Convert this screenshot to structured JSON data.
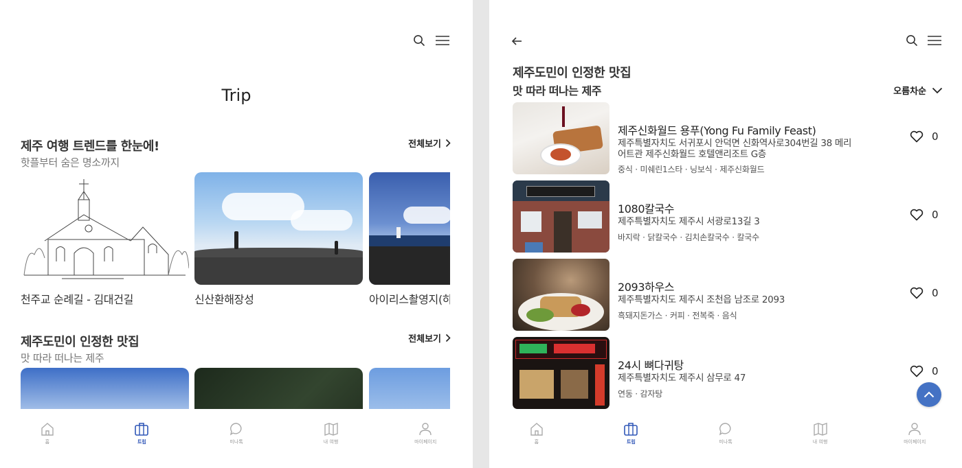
{
  "left": {
    "page_title": "Trip",
    "trends": {
      "title": "제주 여행 트렌드를 한눈에!",
      "subtitle": "핫플부터 숨은 명소까지",
      "see_all": "전체보기",
      "cards": [
        {
          "caption": "천주교 순례길 - 김대건길"
        },
        {
          "caption": "신산환해장성"
        },
        {
          "caption": "아이리스촬영지(하"
        }
      ]
    },
    "restaurants": {
      "title": "제주도민이 인정한 맛집",
      "subtitle": "맛 따라 떠나는 제주",
      "see_all": "전체보기"
    }
  },
  "right": {
    "title": "제주도민이 인정한 맛집",
    "subtitle": "맛 따라 떠나는 제주",
    "sort_label": "오름차순",
    "items": [
      {
        "name": "제주신화월드 용푸(Yong Fu Family Feast)",
        "address": "제주특별자치도 서귀포시 안덕면 신화역사로304번길 38 메리어트관 제주신화월드 호텔앤리조트 G층",
        "tags": "중식 · 미쉐린1스타 · 닝보식 · 제주신화월드",
        "likes": "0"
      },
      {
        "name": "1080칼국수",
        "address": "제주특별자치도 제주시 서광로13길 3",
        "tags": "바지락 · 닭칼국수 · 김치손칼국수 · 칼국수",
        "likes": "0"
      },
      {
        "name": "2093하우스",
        "address": "제주특별자치도 제주시 조천읍 남조로 2093",
        "tags": "흑돼지돈가스 · 커피 · 전복죽 · 음식",
        "likes": "0"
      },
      {
        "name": "24시 뼈다귀탕",
        "address": "제주특별자치도 제주시 삼무로 47",
        "tags": "연동 · 감자탕",
        "likes": "0"
      }
    ]
  },
  "tabbar": [
    {
      "label": "홈",
      "icon": "home-icon"
    },
    {
      "label": "트립",
      "icon": "suitcase-icon",
      "active": true
    },
    {
      "label": "미나톡",
      "icon": "chat-icon"
    },
    {
      "label": "내 여행",
      "icon": "map-icon"
    },
    {
      "label": "마이페이지",
      "icon": "person-icon"
    }
  ],
  "colors": {
    "accent": "#2f56b7",
    "fab": "#4472c4"
  }
}
